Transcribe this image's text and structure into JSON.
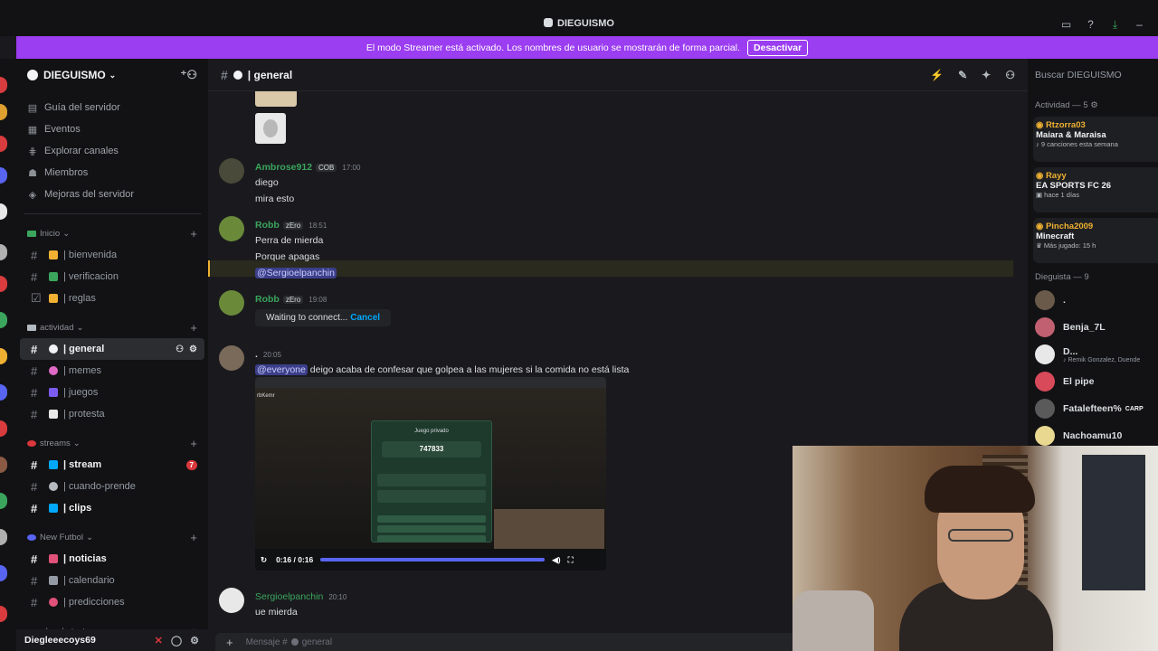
{
  "window": {
    "title": "DIEGUISMO"
  },
  "banner": {
    "text": "El modo Streamer está activado. Los nombres de usuario se mostrarán de forma parcial.",
    "button": "Desactivar",
    "color": "#9b3df0"
  },
  "server": {
    "name": "DIEGUISMO",
    "nav": [
      {
        "label": "Guía del servidor",
        "icon": "guide-icon"
      },
      {
        "label": "Eventos",
        "icon": "calendar-icon"
      },
      {
        "label": "Explorar canales",
        "icon": "browse-icon"
      },
      {
        "label": "Miembros",
        "icon": "members-icon"
      },
      {
        "label": "Mejoras del servidor",
        "icon": "boost-icon"
      }
    ],
    "categories": [
      {
        "name": "Inicio",
        "channels": [
          "| bienvenida",
          "| verificacion",
          "| reglas"
        ]
      },
      {
        "name": "actividad",
        "channels": [
          "| general",
          "| memes",
          "| juegos",
          "| protesta"
        ]
      },
      {
        "name": "streams",
        "channels": [
          "| stream",
          "| cuando-prende",
          "| clips"
        ],
        "stream_badge": "7"
      },
      {
        "name": "New Futbol",
        "channels": [
          "| noticias",
          "| calendario",
          "| predicciones"
        ]
      },
      {
        "name": "canales de texto",
        "channels": []
      }
    ]
  },
  "user": {
    "name": "Diegleeecoys69"
  },
  "chat": {
    "channel": "| general",
    "messages": [
      {
        "author": "Ambrose912",
        "tag": "COB",
        "time": "17:00",
        "lines": [
          "diego",
          "mira esto"
        ],
        "color": "#3ba55d"
      },
      {
        "author": "Robb",
        "tag": "zEro",
        "time": "18:51",
        "lines": [
          "Perra de mierda",
          "Porque apagas"
        ],
        "mention": "@Sergioelpanchin",
        "color": "#3ba55d"
      },
      {
        "author": "Robb",
        "tag": "zEro",
        "time": "19:08",
        "connecting": "Waiting to connect...",
        "cancel": "Cancel",
        "color": "#3ba55d"
      },
      {
        "author": ".",
        "time": "20:05",
        "everyone": "@everyone",
        "text": "deigo acaba de confesar que golpea a las mujeres si la comida no está lista",
        "color": "#dbdee1"
      },
      {
        "author": "Sergioelpanchin",
        "time": "20:10",
        "lines": [
          "ue mierda"
        ],
        "color": "#3ba55d"
      }
    ],
    "video": {
      "time": "0:16 / 0:16",
      "progress": 1.0,
      "panel_title": "Juego privado",
      "code": "747833",
      "header_text": "rbKemr"
    },
    "composer_placeholder": "Mensaje #",
    "composer_channel": "general"
  },
  "members": {
    "search_placeholder": "Buscar DIEGUISMO",
    "activity_header": "Actividad — 5",
    "activities": [
      {
        "user": "Rtzorra03",
        "game": "Maiara & Maraisa",
        "sub": "9 canciones esta semana"
      },
      {
        "user": "Rayy",
        "game": "EA SPORTS FC 26",
        "sub": "hace 1 días"
      },
      {
        "user": "Pincha2009",
        "game": "Minecraft",
        "sub": "Más jugado: 15 h"
      }
    ],
    "group_header": "Dieguista — 9",
    "list": [
      {
        "name": ".",
        "sub": "",
        "color": "#f2f3f5"
      },
      {
        "name": "Benja_7L",
        "sub": "",
        "color": "#f2f3f5"
      },
      {
        "name": "D...",
        "sub": "Remik Gonzalez, Duende",
        "color": "#f2f3f5"
      },
      {
        "name": "El pipe",
        "sub": "",
        "color": "#f2f3f5"
      },
      {
        "name": "Fatalefteen%",
        "sub": "CARP",
        "color": "#f2f3f5"
      },
      {
        "name": "Nachoamu10",
        "sub": "",
        "color": "#f2f3f5"
      }
    ]
  }
}
